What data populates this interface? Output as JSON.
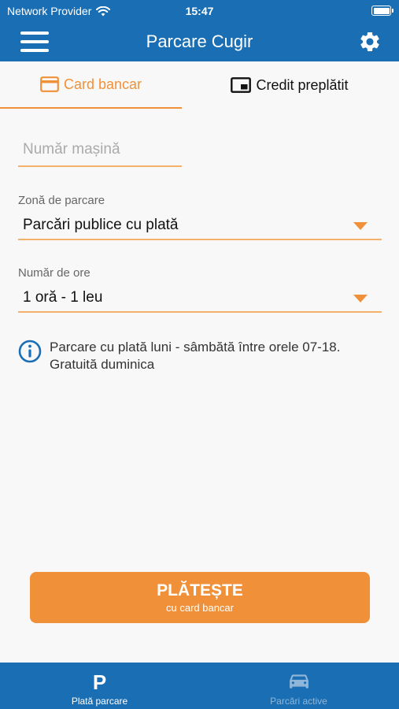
{
  "status_bar": {
    "carrier": "Network Provider",
    "time": "15:47"
  },
  "nav": {
    "title": "Parcare Cugir",
    "menu_icon": "hamburger-menu-icon",
    "settings_icon": "gear-icon"
  },
  "tabs": [
    {
      "label": "Card bancar",
      "icon": "credit-card-icon",
      "active": true
    },
    {
      "label": "Credit preplătit",
      "icon": "prepaid-credit-icon",
      "active": false
    }
  ],
  "form": {
    "plate": {
      "placeholder": "Număr mașină",
      "value": ""
    },
    "zone": {
      "label": "Zonă de parcare",
      "value": "Parcări publice cu plată"
    },
    "hours": {
      "label": "Număr de ore",
      "value": "1 oră - 1 leu"
    }
  },
  "info": {
    "icon": "info-icon",
    "line1": "Parcare cu plată luni - sâmbătă între orele 07-18.",
    "line2": "Gratuită duminica"
  },
  "pay_button": {
    "label": "PLĂTEȘTE",
    "sublabel": "cu card bancar"
  },
  "bottom_tabs": [
    {
      "label": "Plată parcare",
      "icon": "parking-p-icon",
      "active": true
    },
    {
      "label": "Parcări active",
      "icon": "car-icon",
      "active": false
    }
  ],
  "colors": {
    "primary": "#1a6fb4",
    "accent": "#f0913a"
  }
}
